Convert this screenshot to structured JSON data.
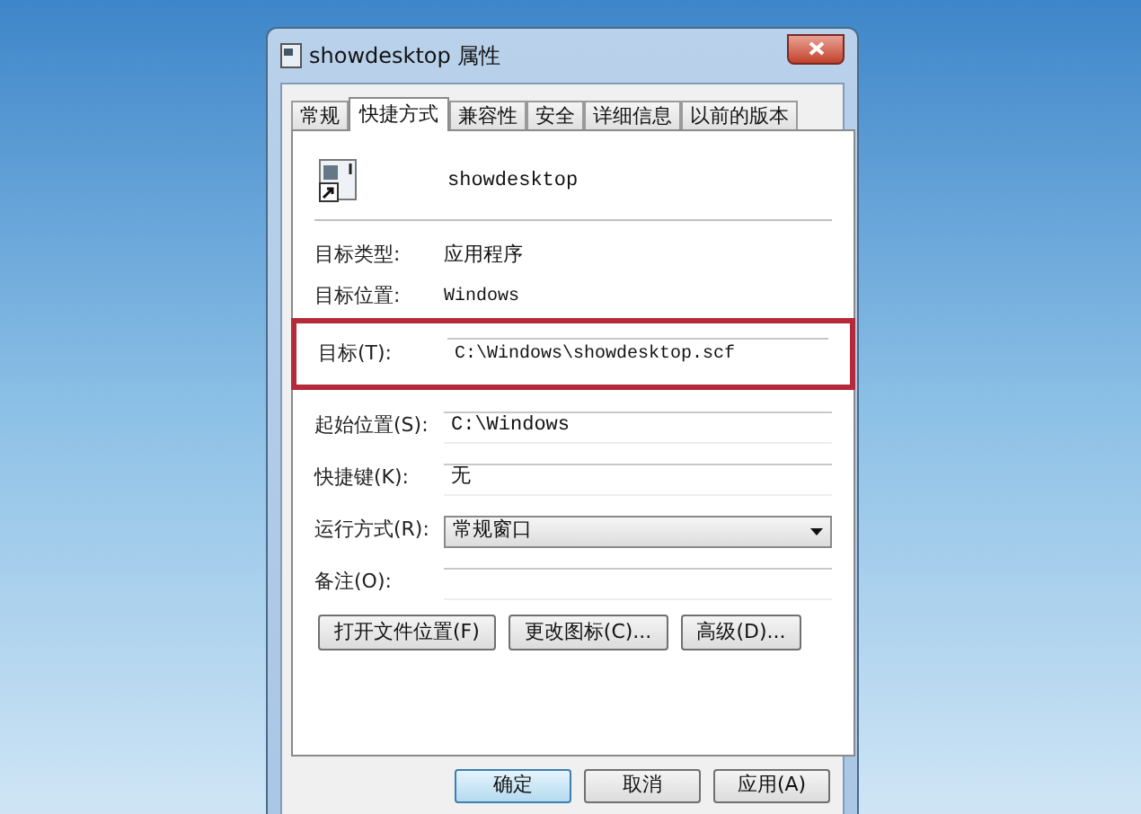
{
  "window": {
    "title": "showdesktop 属性"
  },
  "tabs": [
    {
      "label": "常规",
      "selected": false
    },
    {
      "label": "快捷方式",
      "selected": true
    },
    {
      "label": "兼容性",
      "selected": false
    },
    {
      "label": "安全",
      "selected": false
    },
    {
      "label": "详细信息",
      "selected": false
    },
    {
      "label": "以前的版本",
      "selected": false
    }
  ],
  "shortcut": {
    "name": "showdesktop"
  },
  "info": [
    {
      "label": "目标类型:",
      "value": "应用程序"
    },
    {
      "label": "目标位置:",
      "value": "Windows"
    }
  ],
  "target": {
    "label": "目标(T):",
    "value": "C:\\Windows\\showdesktop.scf",
    "highlighted": true
  },
  "fields": [
    {
      "label": "起始位置(S):",
      "value": "C:\\Windows",
      "kind": "text"
    },
    {
      "label": "快捷键(K):",
      "value": "无",
      "kind": "text"
    },
    {
      "label": "运行方式(R):",
      "value": "常规窗口",
      "kind": "dropdown"
    },
    {
      "label": "备注(O):",
      "kind": "text"
    }
  ],
  "actions": [
    "打开文件位置(F)",
    "更改图标(C)...",
    "高级(D)..."
  ],
  "buttons": [
    {
      "label": "确定",
      "default": true
    },
    {
      "label": "取消",
      "default": false
    },
    {
      "label": "应用(A)",
      "default": false
    }
  ]
}
